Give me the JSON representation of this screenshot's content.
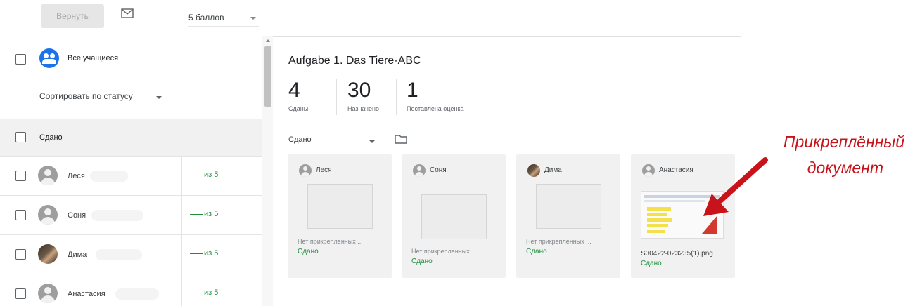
{
  "toolbar": {
    "return_label": "Вернуть",
    "points_value": "5 баллов"
  },
  "left_panel": {
    "all_students_label": "Все учащиеся",
    "sort_label": "Сортировать по статусу",
    "section_label": "Сдано",
    "students": [
      {
        "name": "Леся",
        "grade": "из 5",
        "avatar": "default"
      },
      {
        "name": "Соня",
        "grade": "из 5",
        "avatar": "default"
      },
      {
        "name": "Дима",
        "grade": "из 5",
        "avatar": "photo"
      },
      {
        "name": "Анастасия",
        "grade": "из 5",
        "avatar": "default"
      }
    ]
  },
  "assignment": {
    "title": "Aufgabe 1. Das Tiere-ABC",
    "stats": [
      {
        "value": "4",
        "label": "Сданы"
      },
      {
        "value": "30",
        "label": "Назначено"
      },
      {
        "value": "1",
        "label": "Поставлена оценка"
      }
    ],
    "filter_label": "Сдано"
  },
  "cards": [
    {
      "name": "Леся",
      "attachment": "Нет прикрепленных ...",
      "status": "Сдано"
    },
    {
      "name": "Соня",
      "attachment": "Нет прикрепленных ...",
      "status": "Сдано"
    },
    {
      "name": "Дима",
      "attachment": "Нет прикрепленных ...",
      "status": "Сдано"
    },
    {
      "name": "Анастасия",
      "attachment": "S00422-023235(1).png",
      "status": "Сдано"
    }
  ],
  "annotation": {
    "line1": "Прикреплённый",
    "line2": "документ",
    "color": "#c8131b"
  },
  "colors": {
    "accent_blue": "#1a73e8",
    "success_green": "#1e8e3e"
  },
  "icons": [
    "mail-icon",
    "folder-icon",
    "caret-down-icon",
    "group-icon",
    "person-icon",
    "arrow-icon"
  ]
}
